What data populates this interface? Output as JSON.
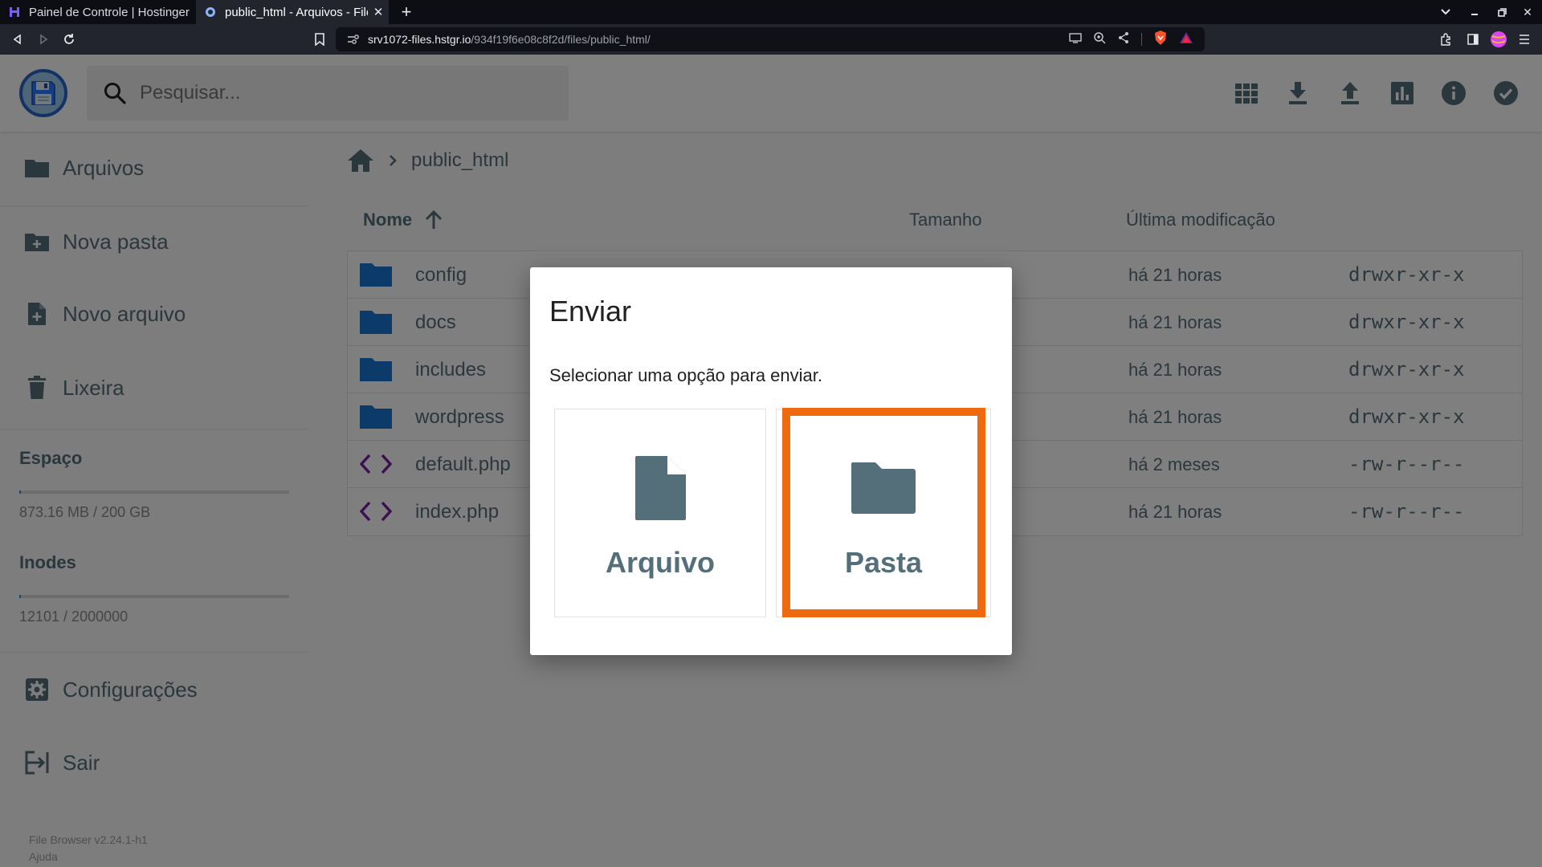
{
  "browser": {
    "tabs": [
      {
        "title": "Painel de Controle | Hostinger",
        "active": false
      },
      {
        "title": "public_html - Arquivos - File Browser",
        "active": true
      }
    ],
    "url_host": "srv1072-files.hstgr.io",
    "url_path": "/934f19f6e08c8f2d/files/public_html/"
  },
  "header": {
    "search_placeholder": "Pesquisar...",
    "actions": [
      "grid-view",
      "download",
      "upload",
      "usage",
      "info",
      "select"
    ]
  },
  "sidebar": {
    "items": [
      {
        "label": "Arquivos",
        "icon": "folder-icon"
      },
      {
        "label": "Nova pasta",
        "icon": "create-folder-icon"
      },
      {
        "label": "Novo arquivo",
        "icon": "new-file-icon"
      },
      {
        "label": "Lixeira",
        "icon": "trash-icon"
      }
    ],
    "space_title": "Espaço",
    "space_text": "873.16 MB / 200 GB",
    "space_fraction": 0.004,
    "inodes_title": "Inodes",
    "inodes_text": "12101 / 2000000",
    "inodes_fraction": 0.006,
    "settings_label": "Configurações",
    "logout_label": "Sair",
    "version": "File Browser v2.24.1-h1",
    "help": "Ajuda"
  },
  "breadcrumb": {
    "current": "public_html"
  },
  "table": {
    "col_name": "Nome",
    "col_size": "Tamanho",
    "col_modified": "Última modificação",
    "rows": [
      {
        "name": "config",
        "type": "folder",
        "modified": "há 21 horas",
        "perms": "drwxr-xr-x"
      },
      {
        "name": "docs",
        "type": "folder",
        "modified": "há 21 horas",
        "perms": "drwxr-xr-x"
      },
      {
        "name": "includes",
        "type": "folder",
        "modified": "há 21 horas",
        "perms": "drwxr-xr-x"
      },
      {
        "name": "wordpress",
        "type": "folder",
        "modified": "há 21 horas",
        "perms": "drwxr-xr-x"
      },
      {
        "name": "default.php",
        "type": "code",
        "modified": "há 2 meses",
        "perms": "-rw-r--r--"
      },
      {
        "name": "index.php",
        "type": "code",
        "modified": "há 21 horas",
        "perms": "-rw-r--r--"
      }
    ]
  },
  "modal": {
    "title": "Enviar",
    "description": "Selecionar uma opção para enviar.",
    "option_file": "Arquivo",
    "option_folder": "Pasta"
  },
  "colors": {
    "accent": "#2196f3",
    "highlight": "#ef6a0e",
    "text": "#546e7a",
    "folder": "#1976d2",
    "code": "#7b1fa2"
  }
}
